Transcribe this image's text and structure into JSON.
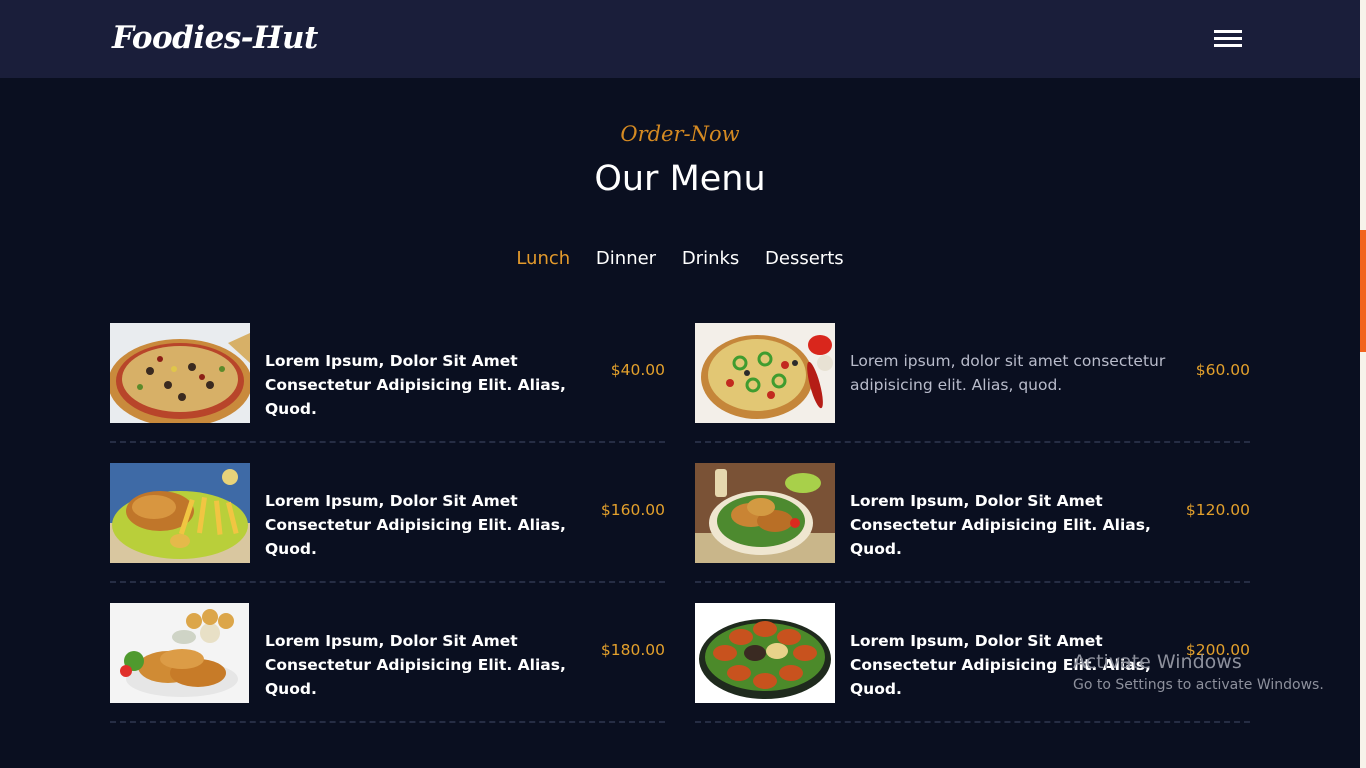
{
  "header": {
    "logo": "Foodies-Hut",
    "menu_icon": "hamburger-menu-icon"
  },
  "section": {
    "subtitle": "Order-Now",
    "title": "Our Menu"
  },
  "tabs": [
    {
      "label": "Lunch",
      "active": true
    },
    {
      "label": "Dinner",
      "active": false
    },
    {
      "label": "Drinks",
      "active": false
    },
    {
      "label": "Desserts",
      "active": false
    }
  ],
  "menu_items": [
    {
      "image": "pizza-photo",
      "description": "Lorem Ipsum, Dolor Sit Amet Consectetur Adipisicing Elit. Alias, Quod.",
      "price": "$40.00"
    },
    {
      "image": "pizza-peppers-photo",
      "description": "Lorem ipsum, dolor sit amet consectetur adipisicing elit. Alias, quod.",
      "price": "$60.00"
    },
    {
      "image": "chicken-fries-photo",
      "description": "Lorem Ipsum, Dolor Sit Amet Consectetur Adipisicing Elit. Alias, Quod.",
      "price": "$160.00"
    },
    {
      "image": "fried-chicken-plate-photo",
      "description": "Lorem Ipsum, Dolor Sit Amet Consectetur Adipisicing Elit. Alias, Quod.",
      "price": "$120.00"
    },
    {
      "image": "chicken-strips-photo",
      "description": "Lorem Ipsum, Dolor Sit Amet Consectetur Adipisicing Elit. Alias, Quod.",
      "price": "$180.00"
    },
    {
      "image": "chicken-wings-platter-photo",
      "description": "Lorem Ipsum, Dolor Sit Amet Consectetur Adipisicing Elit. Alias, Quod.",
      "price": "$200.00"
    }
  ],
  "watermark": {
    "title": "Activate Windows",
    "subtitle": "Go to Settings to activate Windows."
  },
  "colors": {
    "background": "#0a0f20",
    "header": "#1a1e3a",
    "accent": "#e39a2c",
    "scroll_thumb": "#f2641e"
  }
}
